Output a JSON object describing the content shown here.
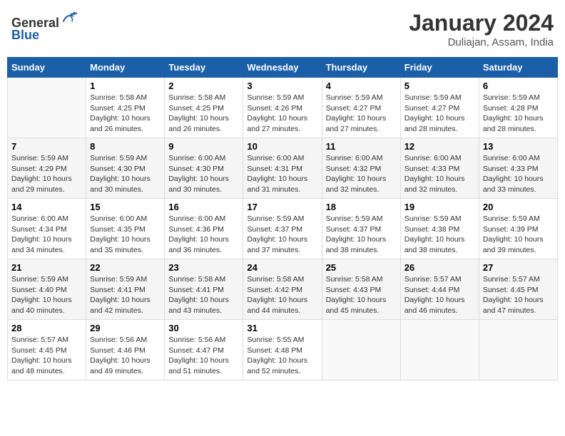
{
  "header": {
    "logo_line1": "General",
    "logo_line2": "Blue",
    "main_title": "January 2024",
    "subtitle": "Duliajan, Assam, India"
  },
  "calendar": {
    "days_of_week": [
      "Sunday",
      "Monday",
      "Tuesday",
      "Wednesday",
      "Thursday",
      "Friday",
      "Saturday"
    ],
    "weeks": [
      [
        {
          "day": "",
          "info": ""
        },
        {
          "day": "1",
          "info": "Sunrise: 5:58 AM\nSunset: 4:25 PM\nDaylight: 10 hours\nand 26 minutes."
        },
        {
          "day": "2",
          "info": "Sunrise: 5:58 AM\nSunset: 4:25 PM\nDaylight: 10 hours\nand 26 minutes."
        },
        {
          "day": "3",
          "info": "Sunrise: 5:59 AM\nSunset: 4:26 PM\nDaylight: 10 hours\nand 27 minutes."
        },
        {
          "day": "4",
          "info": "Sunrise: 5:59 AM\nSunset: 4:27 PM\nDaylight: 10 hours\nand 27 minutes."
        },
        {
          "day": "5",
          "info": "Sunrise: 5:59 AM\nSunset: 4:27 PM\nDaylight: 10 hours\nand 28 minutes."
        },
        {
          "day": "6",
          "info": "Sunrise: 5:59 AM\nSunset: 4:28 PM\nDaylight: 10 hours\nand 28 minutes."
        }
      ],
      [
        {
          "day": "7",
          "info": "Sunrise: 5:59 AM\nSunset: 4:29 PM\nDaylight: 10 hours\nand 29 minutes."
        },
        {
          "day": "8",
          "info": "Sunrise: 5:59 AM\nSunset: 4:30 PM\nDaylight: 10 hours\nand 30 minutes."
        },
        {
          "day": "9",
          "info": "Sunrise: 6:00 AM\nSunset: 4:30 PM\nDaylight: 10 hours\nand 30 minutes."
        },
        {
          "day": "10",
          "info": "Sunrise: 6:00 AM\nSunset: 4:31 PM\nDaylight: 10 hours\nand 31 minutes."
        },
        {
          "day": "11",
          "info": "Sunrise: 6:00 AM\nSunset: 4:32 PM\nDaylight: 10 hours\nand 32 minutes."
        },
        {
          "day": "12",
          "info": "Sunrise: 6:00 AM\nSunset: 4:33 PM\nDaylight: 10 hours\nand 32 minutes."
        },
        {
          "day": "13",
          "info": "Sunrise: 6:00 AM\nSunset: 4:33 PM\nDaylight: 10 hours\nand 33 minutes."
        }
      ],
      [
        {
          "day": "14",
          "info": "Sunrise: 6:00 AM\nSunset: 4:34 PM\nDaylight: 10 hours\nand 34 minutes."
        },
        {
          "day": "15",
          "info": "Sunrise: 6:00 AM\nSunset: 4:35 PM\nDaylight: 10 hours\nand 35 minutes."
        },
        {
          "day": "16",
          "info": "Sunrise: 6:00 AM\nSunset: 4:36 PM\nDaylight: 10 hours\nand 36 minutes."
        },
        {
          "day": "17",
          "info": "Sunrise: 5:59 AM\nSunset: 4:37 PM\nDaylight: 10 hours\nand 37 minutes."
        },
        {
          "day": "18",
          "info": "Sunrise: 5:59 AM\nSunset: 4:37 PM\nDaylight: 10 hours\nand 38 minutes."
        },
        {
          "day": "19",
          "info": "Sunrise: 5:59 AM\nSunset: 4:38 PM\nDaylight: 10 hours\nand 38 minutes."
        },
        {
          "day": "20",
          "info": "Sunrise: 5:59 AM\nSunset: 4:39 PM\nDaylight: 10 hours\nand 39 minutes."
        }
      ],
      [
        {
          "day": "21",
          "info": "Sunrise: 5:59 AM\nSunset: 4:40 PM\nDaylight: 10 hours\nand 40 minutes."
        },
        {
          "day": "22",
          "info": "Sunrise: 5:59 AM\nSunset: 4:41 PM\nDaylight: 10 hours\nand 42 minutes."
        },
        {
          "day": "23",
          "info": "Sunrise: 5:58 AM\nSunset: 4:41 PM\nDaylight: 10 hours\nand 43 minutes."
        },
        {
          "day": "24",
          "info": "Sunrise: 5:58 AM\nSunset: 4:42 PM\nDaylight: 10 hours\nand 44 minutes."
        },
        {
          "day": "25",
          "info": "Sunrise: 5:58 AM\nSunset: 4:43 PM\nDaylight: 10 hours\nand 45 minutes."
        },
        {
          "day": "26",
          "info": "Sunrise: 5:57 AM\nSunset: 4:44 PM\nDaylight: 10 hours\nand 46 minutes."
        },
        {
          "day": "27",
          "info": "Sunrise: 5:57 AM\nSunset: 4:45 PM\nDaylight: 10 hours\nand 47 minutes."
        }
      ],
      [
        {
          "day": "28",
          "info": "Sunrise: 5:57 AM\nSunset: 4:45 PM\nDaylight: 10 hours\nand 48 minutes."
        },
        {
          "day": "29",
          "info": "Sunrise: 5:56 AM\nSunset: 4:46 PM\nDaylight: 10 hours\nand 49 minutes."
        },
        {
          "day": "30",
          "info": "Sunrise: 5:56 AM\nSunset: 4:47 PM\nDaylight: 10 hours\nand 51 minutes."
        },
        {
          "day": "31",
          "info": "Sunrise: 5:55 AM\nSunset: 4:48 PM\nDaylight: 10 hours\nand 52 minutes."
        },
        {
          "day": "",
          "info": ""
        },
        {
          "day": "",
          "info": ""
        },
        {
          "day": "",
          "info": ""
        }
      ]
    ]
  }
}
